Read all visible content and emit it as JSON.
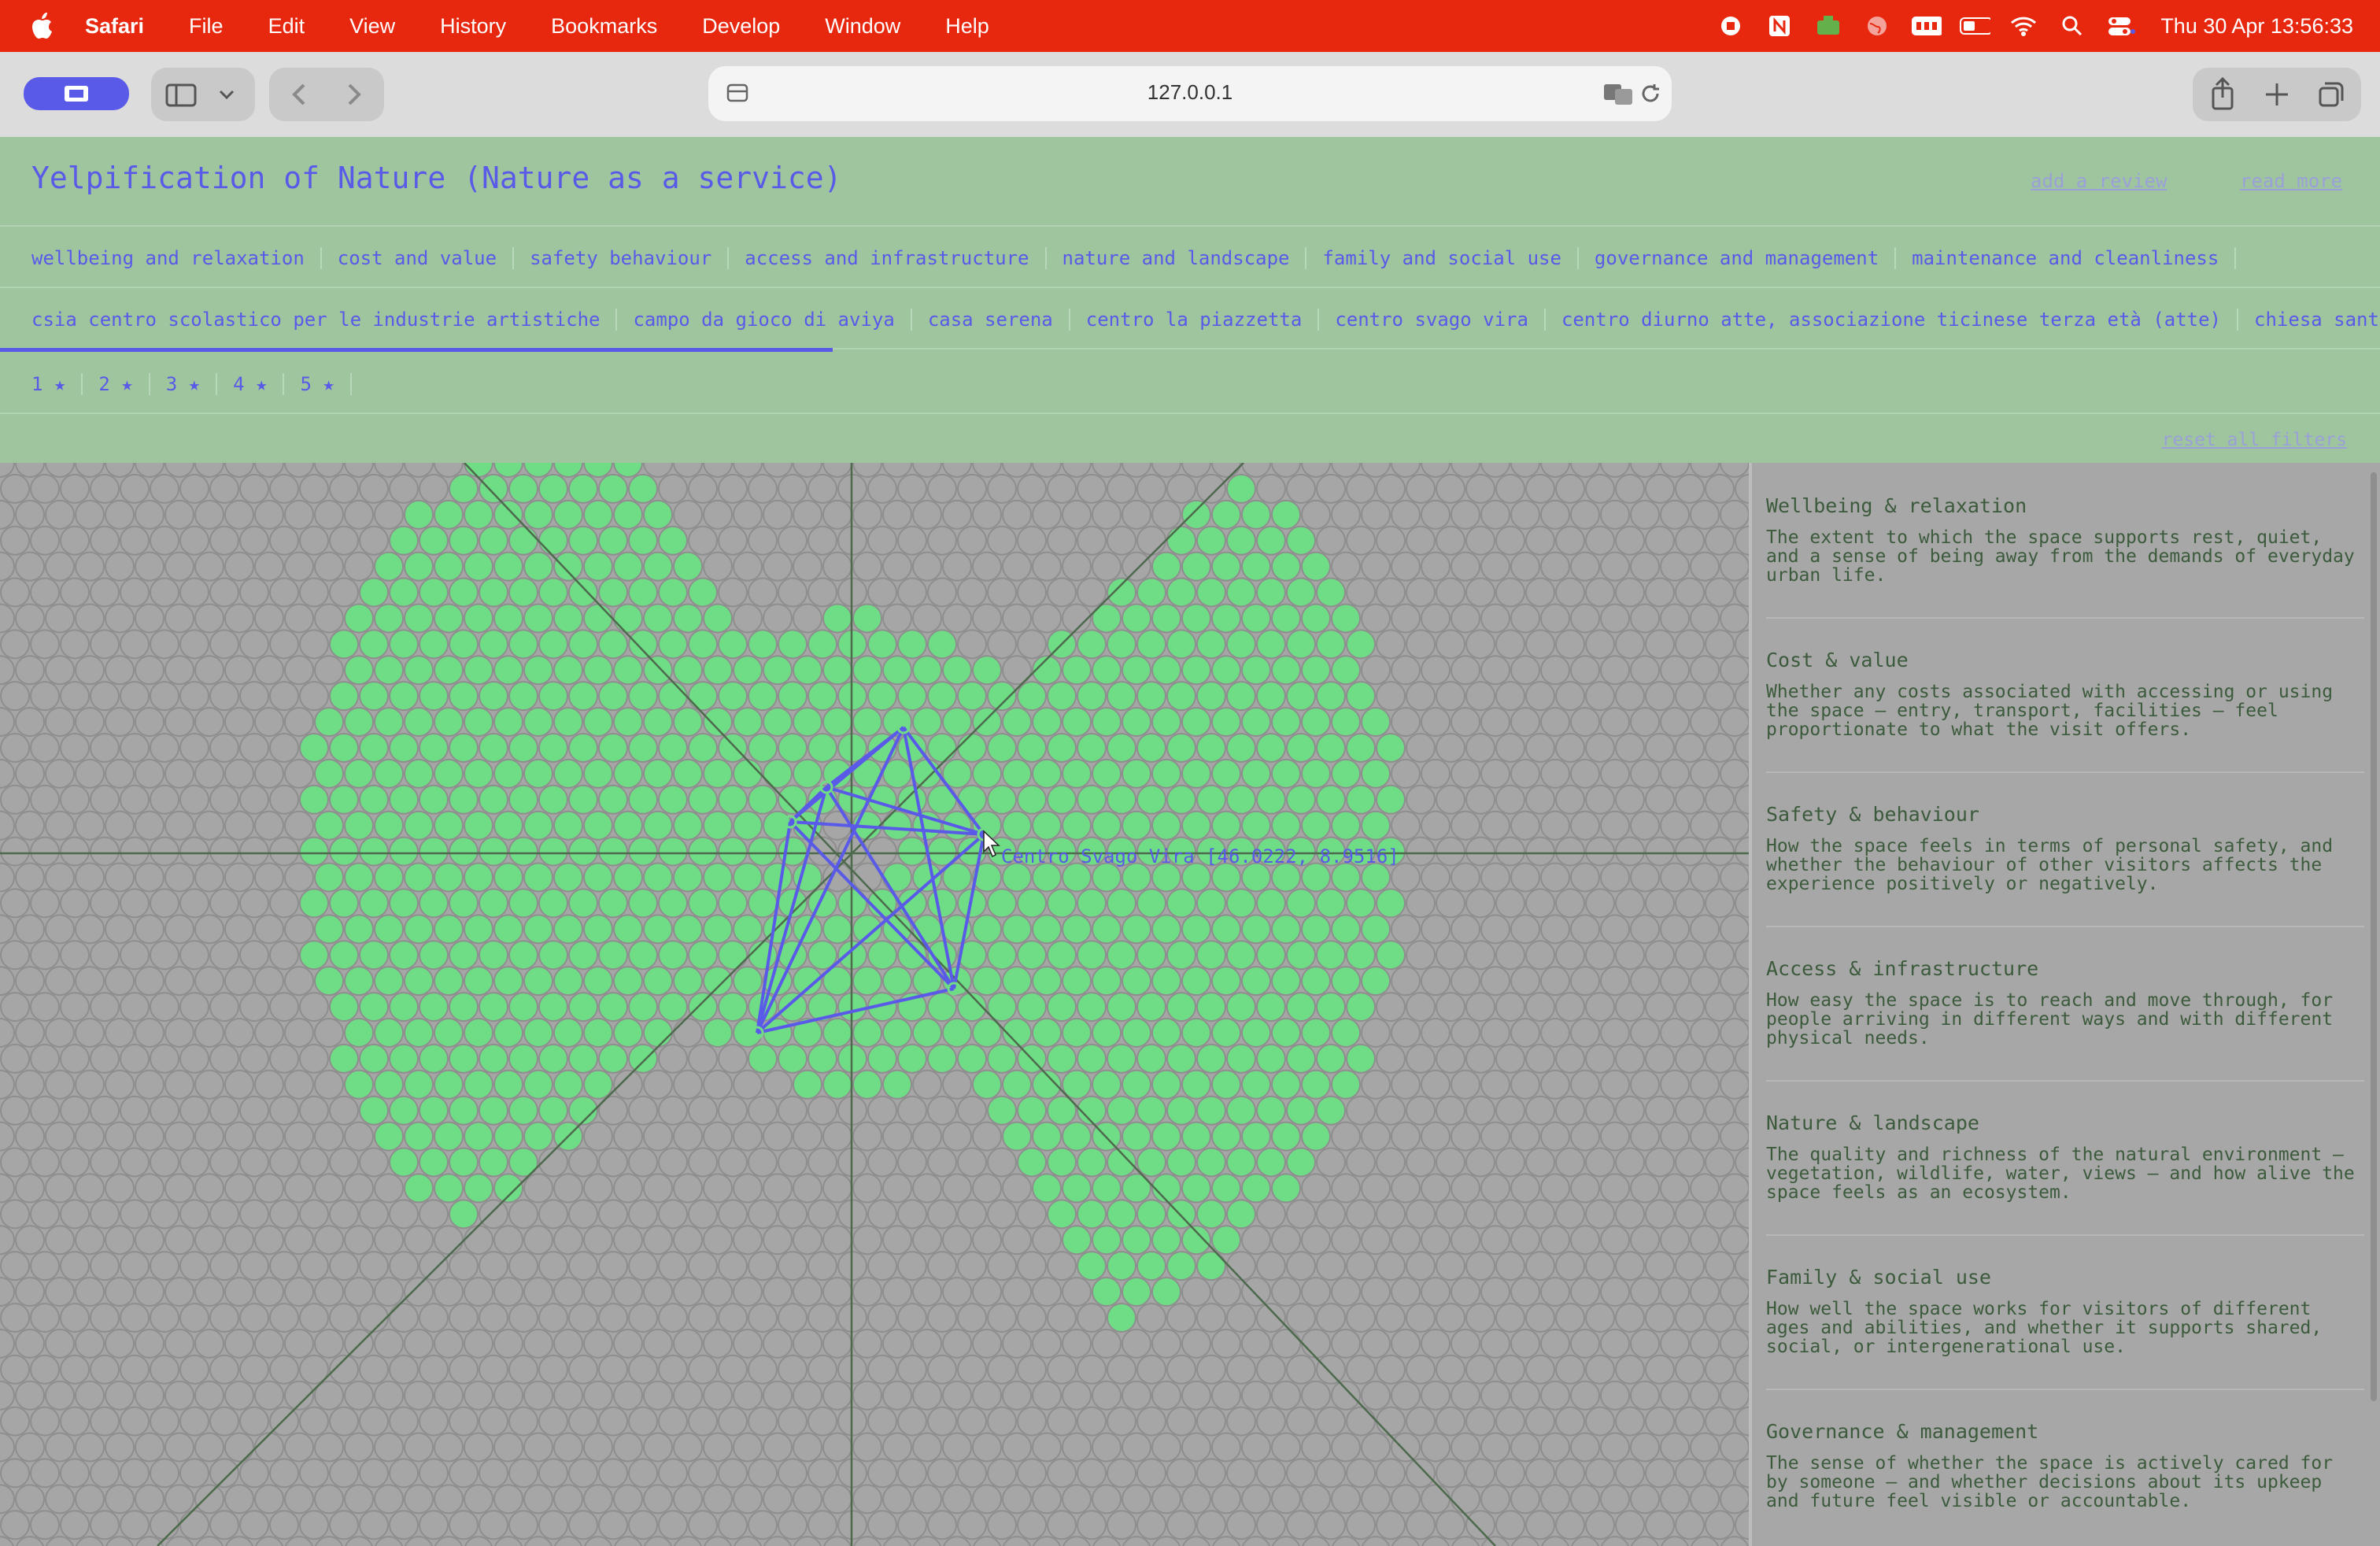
{
  "menubar": {
    "app": "Safari",
    "items": [
      "File",
      "Edit",
      "View",
      "History",
      "Bookmarks",
      "Develop",
      "Window",
      "Help"
    ],
    "clock": "Thu 30 Apr  13:56:33"
  },
  "browser": {
    "url": "127.0.0.1"
  },
  "page": {
    "title": "Yelpification of Nature (Nature as a service)",
    "add_review": "add a review",
    "read_more": "read more",
    "categories": [
      "wellbeing and relaxation",
      "cost and value",
      "safety behaviour",
      "access and infrastructure",
      "nature and landscape",
      "family and social use",
      "governance and management",
      "maintenance and cleanliness"
    ],
    "places": [
      "csia centro scolastico per le industrie artistiche",
      "campo da gioco di aviya",
      "casa serena",
      "centro la piazzetta",
      "centro svago vira",
      "centro diurno atte, associazione ticinese terza età (atte)",
      "chiesa santa"
    ],
    "stars": [
      "1 ★",
      "2 ★",
      "3 ★",
      "4 ★",
      "5 ★"
    ],
    "reset": "reset all filters"
  },
  "map": {
    "tooltip": "Centro Svago Vira [46.0222, 8.9516]",
    "colors": {
      "dot_fill": "#6fdd86",
      "dot_empty": "#a6a6a6",
      "polygon": "#5a5ae8",
      "axis": "#4d6a4d"
    }
  },
  "sidebar": {
    "cards": [
      {
        "title": "Wellbeing & relaxation",
        "text": "The extent to which the space supports rest, quiet, and a sense of being away from the demands of everyday urban life."
      },
      {
        "title": "Cost & value",
        "text": "Whether any costs associated with accessing or using the space — entry, transport, facilities — feel proportionate to what the visit offers."
      },
      {
        "title": "Safety & behaviour",
        "text": "How the space feels in terms of personal safety, and whether the behaviour of other visitors affects the experience positively or negatively."
      },
      {
        "title": "Access & infrastructure",
        "text": "How easy the space is to reach and move through, for people arriving in different ways and with different physical needs."
      },
      {
        "title": "Nature & landscape",
        "text": "The quality and richness of the natural environment — vegetation, wildlife, water, views — and how alive the space feels as an ecosystem."
      },
      {
        "title": "Family & social use",
        "text": "How well the space works for visitors of different ages and abilities, and whether it supports shared, social, or intergenerational use."
      },
      {
        "title": "Governance & management",
        "text": "The sense of whether the space is actively cared for by someone — and whether decisions about its upkeep and future feel visible or accountable."
      }
    ]
  }
}
